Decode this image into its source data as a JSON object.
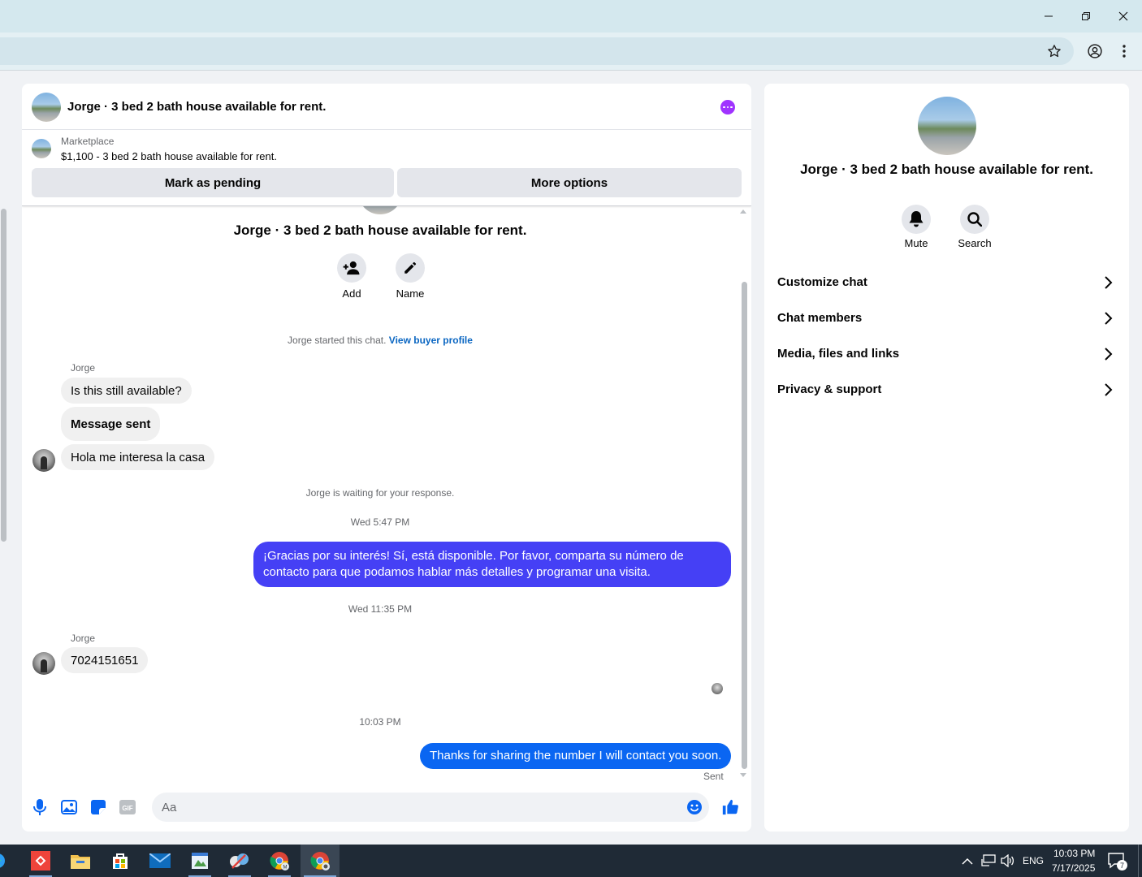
{
  "chat": {
    "header_title": "Jorge · 3 bed 2 bath house available for rent.",
    "listing_category": "Marketplace",
    "listing_price_title": "$1,100 - 3 bed 2 bath house available for rent.",
    "mark_pending_label": "Mark as pending",
    "more_options_label": "More options",
    "conversation_title": "Jorge · 3 bed 2 bath house available for rent.",
    "add_label": "Add",
    "name_label": "Name",
    "started_text": "Jorge started this chat.",
    "buyer_profile_link": "View buyer profile",
    "sender_name_1": "Jorge",
    "msg_in_1": "Is this still available?",
    "msg_in_2": "Message sent",
    "msg_in_3": "Hola me interesa la casa",
    "waiting_text": "Jorge is waiting for your response.",
    "timestamp_1": "Wed 5:47 PM",
    "msg_out_1": "¡Gracias por su interés! Sí, está disponible. Por favor, comparta su número de contacto para que podamos hablar más detalles y programar una visita.",
    "timestamp_2": "Wed 11:35 PM",
    "sender_name_2": "Jorge",
    "msg_in_4": "7024151651",
    "timestamp_3": "10:03 PM",
    "msg_out_2": "Thanks for sharing the number I will contact you soon.",
    "sent_status": "Sent",
    "composer_placeholder": "Aa",
    "colors": {
      "outgoing_1": "#4540f5",
      "outgoing_2": "#0a66f2",
      "accent": "#0a66c2"
    }
  },
  "info": {
    "title": "Jorge · 3 bed 2 bath house available for rent.",
    "mute_label": "Mute",
    "search_label": "Search",
    "menu": [
      {
        "label": "Customize chat"
      },
      {
        "label": "Chat members"
      },
      {
        "label": "Media, files and links"
      },
      {
        "label": "Privacy & support"
      }
    ]
  },
  "taskbar": {
    "language": "ENG",
    "time": "10:03 PM",
    "date": "7/17/2025",
    "notification_count": "7"
  }
}
